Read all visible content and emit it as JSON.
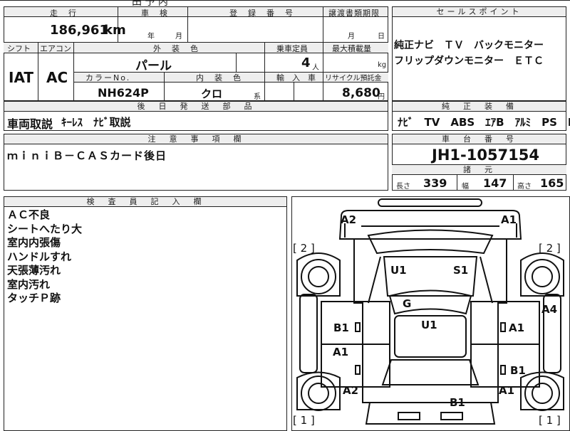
{
  "top_fragment": "田 予 内",
  "row1": {
    "mileage_header": "走　行",
    "mileage_value": "186,961",
    "mileage_unit": "km",
    "inspection_header": "車　検",
    "inspection_year": "年",
    "inspection_month": "月",
    "registration_header": "登　録　番　号",
    "transfer_header": "譲渡書類期限",
    "transfer_month": "月",
    "transfer_day": "日"
  },
  "row2": {
    "shift_header": "シフト",
    "ac_header": "エアコン",
    "shift_value": "IAT",
    "ac_value": "AC",
    "exterior_header": "外　装　色",
    "exterior_value": "パール",
    "capacity_header": "乗車定員",
    "capacity_value": "4",
    "capacity_unit": "人",
    "load_header": "最大積載量",
    "load_unit": "kg",
    "color_no_header": "カラーNo.",
    "color_no_value": "NH624P",
    "interior_header": "内　装　色",
    "interior_value": "クロ",
    "interior_suffix": "系",
    "import_header": "輸　入　車",
    "recycle_header": "リサイクル預託金",
    "recycle_value": "8,680",
    "recycle_unit": "円"
  },
  "parts": {
    "header": "後　日　発　送　部　品",
    "text_bold": "車両取説",
    "text_rest": "ｷｰﾚｽ　ﾅﾋﾞ取説"
  },
  "notes": {
    "header": "注　意　事　項　欄",
    "text": "ｍｉｎｉＢ－ＣＡＳカード後日"
  },
  "sales": {
    "header": "セールスポイント",
    "line1": "純正ナビ　ＴＶ　バックモニター",
    "line2": "フリップダウンモニター　ＥＴＣ"
  },
  "equipment": {
    "header": "純　正　装　備",
    "value": "ﾅﾋﾞ　TV　ABS　ｴｱB　ｱﾙﾐ　PS　PW"
  },
  "chassis": {
    "header": "車　台　番　号",
    "value": "JH1-1057154"
  },
  "dimensions": {
    "header": "諸　元",
    "length_label": "長さ",
    "length_value": "339",
    "width_label": "幅",
    "width_value": "147",
    "height_label": "高さ",
    "height_value": "165"
  },
  "inspector": {
    "header": "検　査　員　記　入　欄",
    "lines": [
      "ＡＣ不良",
      "シートへたり大",
      "室内内張傷",
      "ハンドルすれ",
      "天張薄汚れ",
      "室内汚れ",
      "タッチＰ跡"
    ]
  },
  "diagram": {
    "front_left": "A2",
    "front_right": "A1",
    "side_left_top": "[ 2 ]",
    "side_right_top": "[ 2 ]",
    "u1_upper": "U1",
    "s1": "S1",
    "g": "G",
    "u1_center": "U1",
    "b1_left": "B1",
    "a1_right_upper": "A1",
    "a4": "A4",
    "a1_left": "A1",
    "b1_right": "B1",
    "a2_rear_left": "A2",
    "a1_rear_right": "A1",
    "b1_rear": "B1",
    "side_left_bottom": "[ 1 ]",
    "side_right_bottom": "[ 1 ]"
  }
}
